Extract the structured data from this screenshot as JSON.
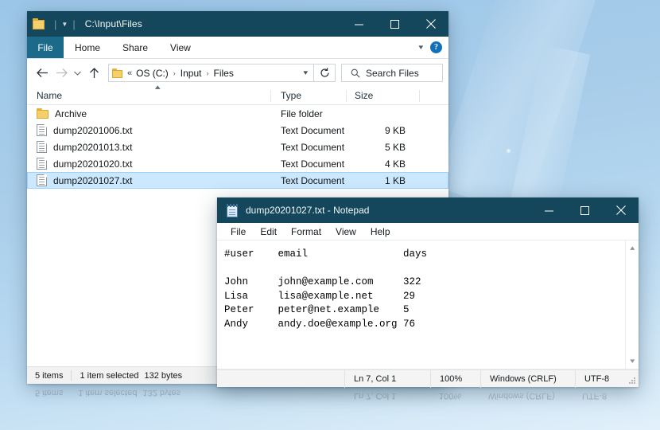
{
  "explorer": {
    "title": "C:\\Input\\Files",
    "quick_access": {
      "folder_icon": "folder-icon",
      "dropdown_icon": "chevron-down-icon"
    },
    "window_controls": {
      "minimize": "minimize-icon",
      "maximize": "maximize-icon",
      "close": "close-icon"
    },
    "ribbon": {
      "tabs": [
        "File",
        "Home",
        "Share",
        "View"
      ],
      "collapse_icon": "chevron-up-icon",
      "help_label": "?"
    },
    "nav": {
      "back_icon": "arrow-left-icon",
      "forward_icon": "arrow-right-icon",
      "recent_icon": "chevron-down-icon",
      "up_icon": "arrow-up-icon",
      "breadcrumb_prefix": "«",
      "breadcrumbs": [
        "OS (C:)",
        "Input",
        "Files"
      ],
      "breadcrumb_sep": "›",
      "address_dropdown_icon": "chevron-down-icon",
      "refresh_icon": "refresh-icon"
    },
    "search": {
      "icon": "search-icon",
      "placeholder": "Search Files"
    },
    "columns": [
      {
        "key": "name",
        "label": "Name",
        "sorted": "asc"
      },
      {
        "key": "type",
        "label": "Type"
      },
      {
        "key": "size",
        "label": "Size"
      }
    ],
    "sort_indicator_icon": "chevron-up-icon",
    "files": [
      {
        "name": "Archive",
        "type": "File folder",
        "size": "",
        "icon": "folder-icon",
        "selected": false
      },
      {
        "name": "dump20201006.txt",
        "type": "Text Document",
        "size": "9 KB",
        "icon": "text-document-icon",
        "selected": false
      },
      {
        "name": "dump20201013.txt",
        "type": "Text Document",
        "size": "5 KB",
        "icon": "text-document-icon",
        "selected": false
      },
      {
        "name": "dump20201020.txt",
        "type": "Text Document",
        "size": "4 KB",
        "icon": "text-document-icon",
        "selected": false
      },
      {
        "name": "dump20201027.txt",
        "type": "Text Document",
        "size": "1 KB",
        "icon": "text-document-icon",
        "selected": true
      }
    ],
    "status": {
      "item_count": "5 items",
      "selection": "1 item selected",
      "selection_size": "132 bytes"
    }
  },
  "notepad": {
    "title": "dump20201027.txt - Notepad",
    "icon": "notepad-icon",
    "window_controls": {
      "minimize": "minimize-icon",
      "maximize": "maximize-icon",
      "close": "close-icon"
    },
    "menu": [
      "File",
      "Edit",
      "Format",
      "View",
      "Help"
    ],
    "content": "#user    email                days\n\nJohn     john@example.com     322\nLisa     lisa@example.net     29\nPeter    peter@net.example    5\nAndy     andy.doe@example.org 76",
    "scrollbar": {
      "up_icon": "chevron-up-icon",
      "down_icon": "chevron-down-icon"
    },
    "status": {
      "position": "Ln 7, Col 1",
      "zoom": "100%",
      "line_ending": "Windows (CRLF)",
      "encoding": "UTF-8"
    },
    "resize_grip_icon": "resize-grip-icon"
  },
  "desktop": {
    "background_top_color": "#9cc6e8",
    "background_bottom_color": "#e2f0fa",
    "accent_titlebar_color": "#15475c",
    "selection_color": "#cce8ff"
  }
}
